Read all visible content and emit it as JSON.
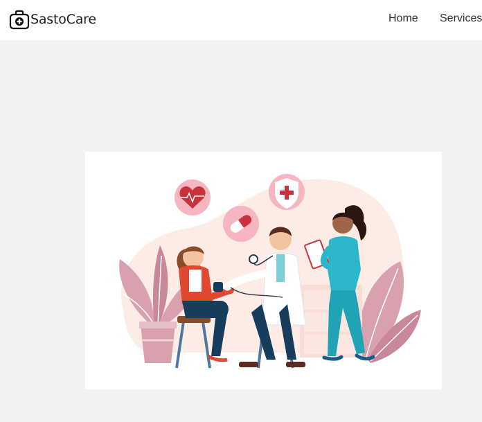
{
  "header": {
    "brand": {
      "icon": "medical-briefcase-icon",
      "name": "SastoCare"
    },
    "nav": [
      {
        "label": "Home"
      },
      {
        "label": "Services"
      }
    ]
  },
  "hero": {
    "illustration": "medical-checkup-illustration",
    "icons": [
      "heartbeat-icon",
      "capsule-pill-icon",
      "medical-cross-shield-icon",
      "stethoscope-icon"
    ]
  },
  "colors": {
    "header_bg": "#ffffff",
    "page_bg": "#f2f2f2",
    "accent_pink": "#f6b6c1",
    "accent_red": "#c9323d",
    "scrubs_teal": "#2bb7c9"
  }
}
